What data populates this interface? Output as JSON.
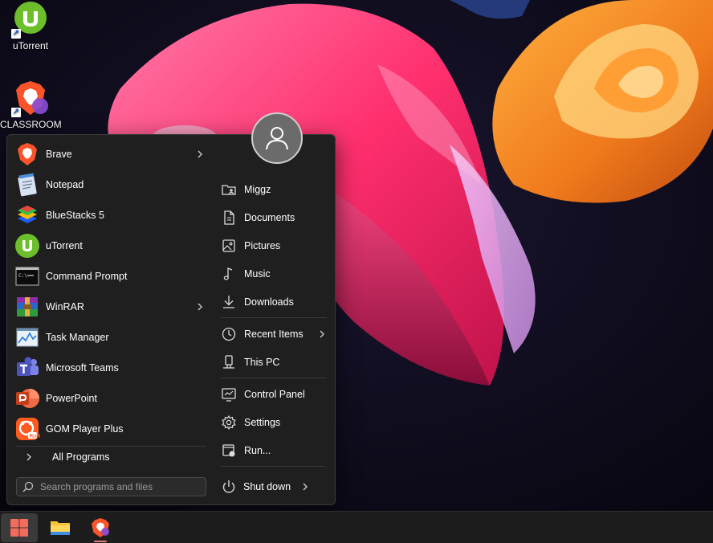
{
  "desktop": {
    "icons": [
      {
        "label": "uTorrent",
        "icon": "utorrent-icon"
      },
      {
        "label": "CLASSROOM",
        "icon": "brave-icon"
      }
    ]
  },
  "start_menu": {
    "apps": [
      {
        "label": "Brave",
        "icon": "brave-icon",
        "has_submenu": true
      },
      {
        "label": "Notepad",
        "icon": "notepad-icon",
        "has_submenu": false
      },
      {
        "label": "BlueStacks 5",
        "icon": "bluestacks-icon",
        "has_submenu": false
      },
      {
        "label": "uTorrent",
        "icon": "utorrent-icon",
        "has_submenu": false
      },
      {
        "label": "Command Prompt",
        "icon": "command-prompt-icon",
        "has_submenu": false
      },
      {
        "label": "WinRAR",
        "icon": "winrar-icon",
        "has_submenu": true
      },
      {
        "label": "Task Manager",
        "icon": "task-manager-icon",
        "has_submenu": false
      },
      {
        "label": "Microsoft Teams",
        "icon": "teams-icon",
        "has_submenu": false
      },
      {
        "label": "PowerPoint",
        "icon": "powerpoint-icon",
        "has_submenu": false
      },
      {
        "label": "GOM Player Plus",
        "icon": "gom-player-icon",
        "has_submenu": false
      }
    ],
    "all_programs_label": "All Programs",
    "search_placeholder": "Search programs and files",
    "places": [
      {
        "label": "Miggz",
        "icon": "user-folder-icon"
      },
      {
        "label": "Documents",
        "icon": "document-icon"
      },
      {
        "label": "Pictures",
        "icon": "picture-icon"
      },
      {
        "label": "Music",
        "icon": "music-icon"
      },
      {
        "label": "Downloads",
        "icon": "download-icon"
      },
      {
        "label": "Recent Items",
        "icon": "clock-icon",
        "has_submenu": true
      },
      {
        "label": "This PC",
        "icon": "computer-icon"
      },
      {
        "label": "Control Panel",
        "icon": "control-panel-icon"
      },
      {
        "label": "Settings",
        "icon": "gear-icon"
      },
      {
        "label": "Run...",
        "icon": "run-icon"
      }
    ],
    "shutdown_label": "Shut down"
  },
  "taskbar": {
    "buttons": [
      {
        "icon": "start-icon",
        "active": true
      },
      {
        "icon": "file-explorer-icon",
        "active": false
      },
      {
        "icon": "brave-icon",
        "active": false
      }
    ]
  },
  "colors": {
    "menu_bg": "#1f1f1f",
    "taskbar_bg": "#1c1c1c",
    "start_accent": "#f26b5b"
  }
}
